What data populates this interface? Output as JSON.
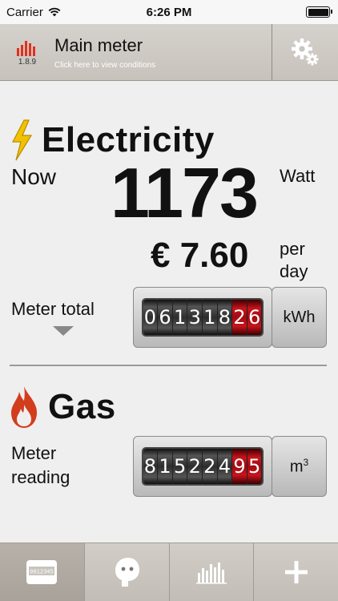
{
  "status_bar": {
    "carrier": "Carrier",
    "time": "6:26 PM"
  },
  "header": {
    "meter_code": "1.8.9",
    "title": "Main meter",
    "subtitle": "Click here to view conditions",
    "icons": {
      "meter": "meter-bars-icon",
      "settings": "gears-icon"
    }
  },
  "electricity": {
    "title": "Electricity",
    "now_label": "Now",
    "power_value": "1173",
    "power_unit": "Watt",
    "cost_value": "€ 7.60",
    "cost_unit_line1": "per",
    "cost_unit_line2": "day",
    "meter_total_label": "Meter total",
    "odometer_digits": [
      "0",
      "6",
      "1",
      "3",
      "1",
      "8",
      "2",
      "6"
    ],
    "odometer_decimals": 2,
    "unit": "kWh"
  },
  "gas": {
    "title": "Gas",
    "reading_label_line1": "Meter",
    "reading_label_line2": "reading",
    "odometer_digits": [
      "8",
      "1",
      "5",
      "2",
      "2",
      "4",
      "9",
      "5"
    ],
    "odometer_decimals": 2,
    "unit": "m",
    "unit_sup": "3"
  },
  "tab_bar": {
    "active_index": 0,
    "meter_display_text": "0012345",
    "icons": [
      "meter-display-icon",
      "plug-icon",
      "bar-chart-icon",
      "add-icon"
    ]
  },
  "colors": {
    "header_bg": "#cfcac4",
    "background": "#efefef",
    "lightning": "#f2c200",
    "flame": "#d23d1e",
    "meter_red": "#c8141c",
    "meter_badge_red": "#e0301e"
  }
}
